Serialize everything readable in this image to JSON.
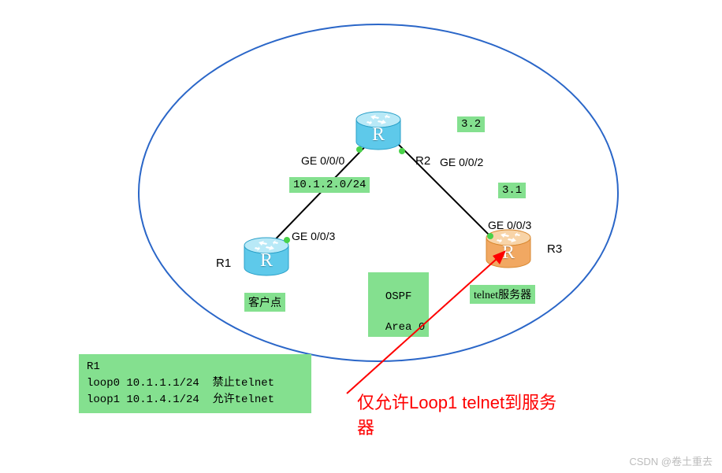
{
  "routers": {
    "r1": {
      "name": "R1",
      "letter": "R",
      "color": "blue",
      "label": "客户点"
    },
    "r2": {
      "name": "R2",
      "letter": "R",
      "color": "blue",
      "label": ""
    },
    "r3": {
      "name": "R3",
      "letter": "R",
      "color": "orange",
      "label": "telnet服务器"
    }
  },
  "interfaces": {
    "r2_ge000": "GE 0/0/0",
    "r2_ge002": "GE 0/0/2",
    "r1_ge003": "GE 0/0/3",
    "r3_ge003": "GE 0/0/3"
  },
  "subnets": {
    "r1r2": "10.1.2.0/24",
    "r2r3_top": "3.2",
    "r2r3_mid": "3.1"
  },
  "area": {
    "line1": "OSPF",
    "line2": "Area 0"
  },
  "infobox": {
    "title": "R1",
    "row1": "loop0 10.1.1.1/24  禁止telnet",
    "row2": "loop1 10.1.4.1/24  允许telnet"
  },
  "annotation": {
    "line1": "仅允许Loop1 telnet到服务",
    "line2": "器"
  },
  "watermark": "CSDN @卷土重去"
}
